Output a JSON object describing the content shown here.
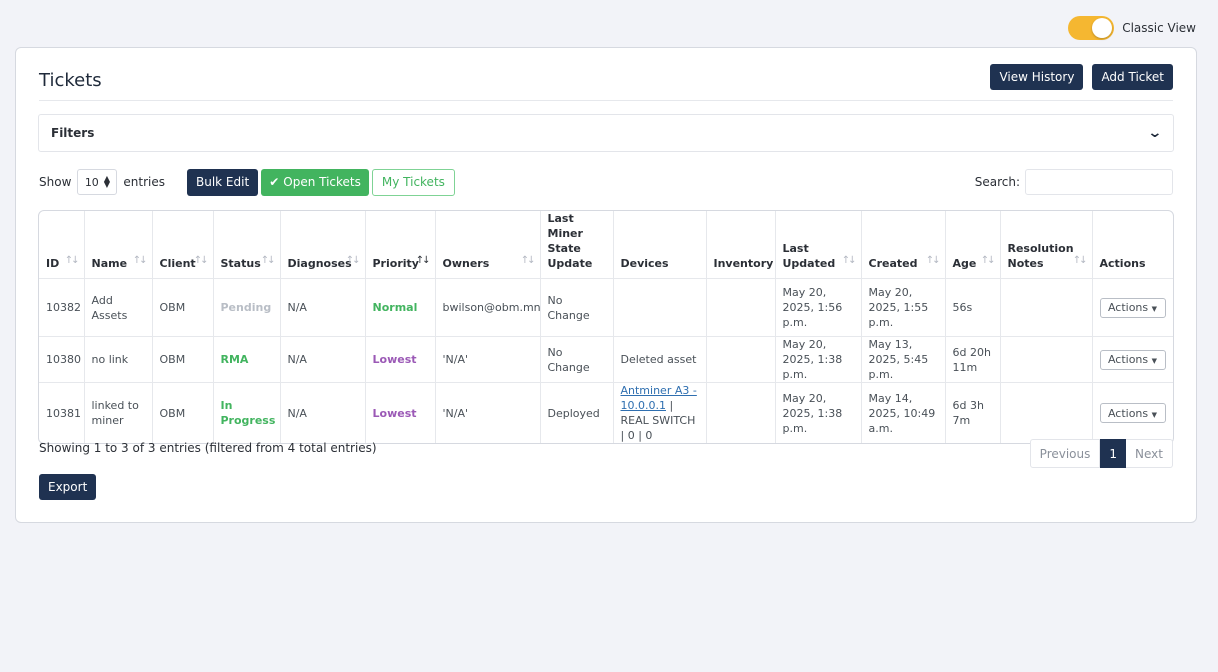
{
  "view_toggle": {
    "label": "Classic View",
    "on": true,
    "color": "#f5b731"
  },
  "card": {
    "title": "Tickets",
    "view_history_label": "View History",
    "add_ticket_label": "Add Ticket"
  },
  "filters": {
    "label": "Filters",
    "icon": "chevron-down-icon"
  },
  "controls": {
    "show_label": "Show",
    "entries_value": "10",
    "entries_label": "entries",
    "bulk_edit_label": "Bulk Edit",
    "open_tickets_label": "Open Tickets",
    "my_tickets_label": "My Tickets",
    "search_label": "Search:",
    "search_value": ""
  },
  "table": {
    "columns": [
      "ID",
      "Name",
      "Client",
      "Status",
      "Diagnoses",
      "Priority",
      "Owners",
      "Last Miner State Update",
      "Devices",
      "Inventory",
      "Last Updated",
      "Created",
      "Age",
      "Resolution Notes",
      "Actions"
    ],
    "rows": [
      {
        "id": "10382",
        "name": "Add Assets",
        "client": "OBM",
        "status": "Pending",
        "diagnoses": "N/A",
        "priority": "Normal",
        "owners": "bwilson@obm.mn",
        "last_miner_state": "No Change",
        "devices_link": "",
        "devices_text": "",
        "inventory": "",
        "last_updated": "May 20, 2025, 1:56 p.m.",
        "created": "May 20, 2025, 1:55 p.m.",
        "age": "56s",
        "resolution_notes": "",
        "actions": "Actions"
      },
      {
        "id": "10380",
        "name": "no link",
        "client": "OBM",
        "status": "RMA",
        "diagnoses": "N/A",
        "priority": "Lowest",
        "owners": "'N/A'",
        "last_miner_state": "No Change",
        "devices_link": "",
        "devices_text": "Deleted asset",
        "inventory": "",
        "last_updated": "May 20, 2025, 1:38 p.m.",
        "created": "May 13, 2025, 5:45 p.m.",
        "age": "6d 20h 11m",
        "resolution_notes": "",
        "actions": "Actions"
      },
      {
        "id": "10381",
        "name": "linked to miner",
        "client": "OBM",
        "status": "In Progress",
        "diagnoses": "N/A",
        "priority": "Lowest",
        "owners": "'N/A'",
        "last_miner_state": "Deployed",
        "devices_link": "Antminer A3 - 10.0.0.1",
        "devices_text": " | REAL SWITCH | 0 | 0",
        "inventory": "",
        "last_updated": "May 20, 2025, 1:38 p.m.",
        "created": "May 14, 2025, 10:49 a.m.",
        "age": "6d 3h 7m",
        "resolution_notes": "",
        "actions": "Actions"
      }
    ]
  },
  "footer": {
    "info": "Showing 1 to 3 of 3 entries (filtered from 4 total entries)",
    "previous_label": "Previous",
    "current_page": "1",
    "next_label": "Next",
    "export_label": "Export"
  },
  "colors": {
    "primary_dark": "#1f3251",
    "success_green": "#42b45f",
    "priority_purple": "#9b59b6",
    "pending_gray": "#b9bec6",
    "link_blue": "#2f6fb0"
  }
}
